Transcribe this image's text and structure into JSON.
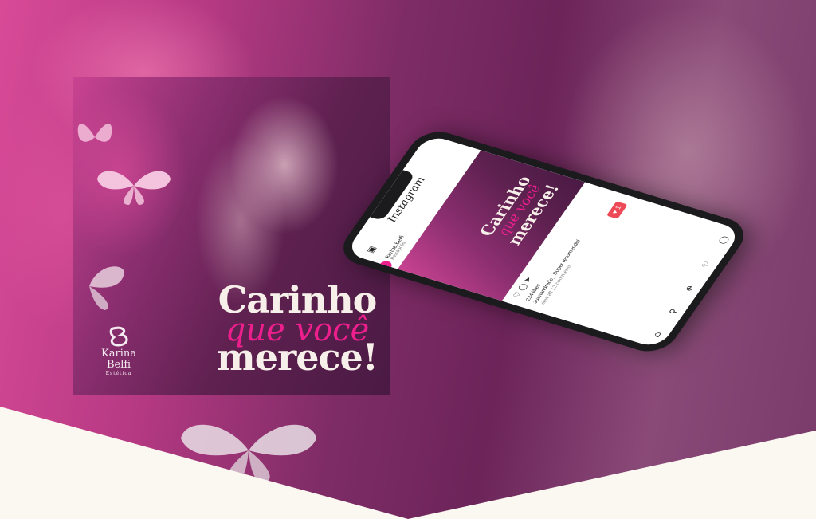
{
  "post": {
    "title_line1": "Carinho",
    "title_line2": "que você",
    "title_line3": "merece!",
    "brand_name_line1": "Karina",
    "brand_name_line2": "Belfi",
    "brand_tagline": "Estética"
  },
  "phone": {
    "app_title": "Instagram",
    "username": "karina.belfi",
    "user_subtitle": "Petrópolis",
    "post_title_line1": "Carinho",
    "post_title_line2": "que você",
    "post_title_line3": "merece!",
    "likes": "234 likes",
    "caption": "Juanandrade_ Super recomendo!",
    "comments_link": "view all 12 comments",
    "notification_count": "1"
  },
  "colors": {
    "accent": "#ec1f8d",
    "cream": "#fbf8f1",
    "title_light": "#f7efe9",
    "notification": "#ed4956"
  },
  "icons": [
    "butterfly-icon",
    "brand-logo-icon",
    "heart-icon",
    "comment-icon",
    "share-icon",
    "home-icon",
    "search-icon",
    "add-icon",
    "profile-icon",
    "camera-icon"
  ]
}
